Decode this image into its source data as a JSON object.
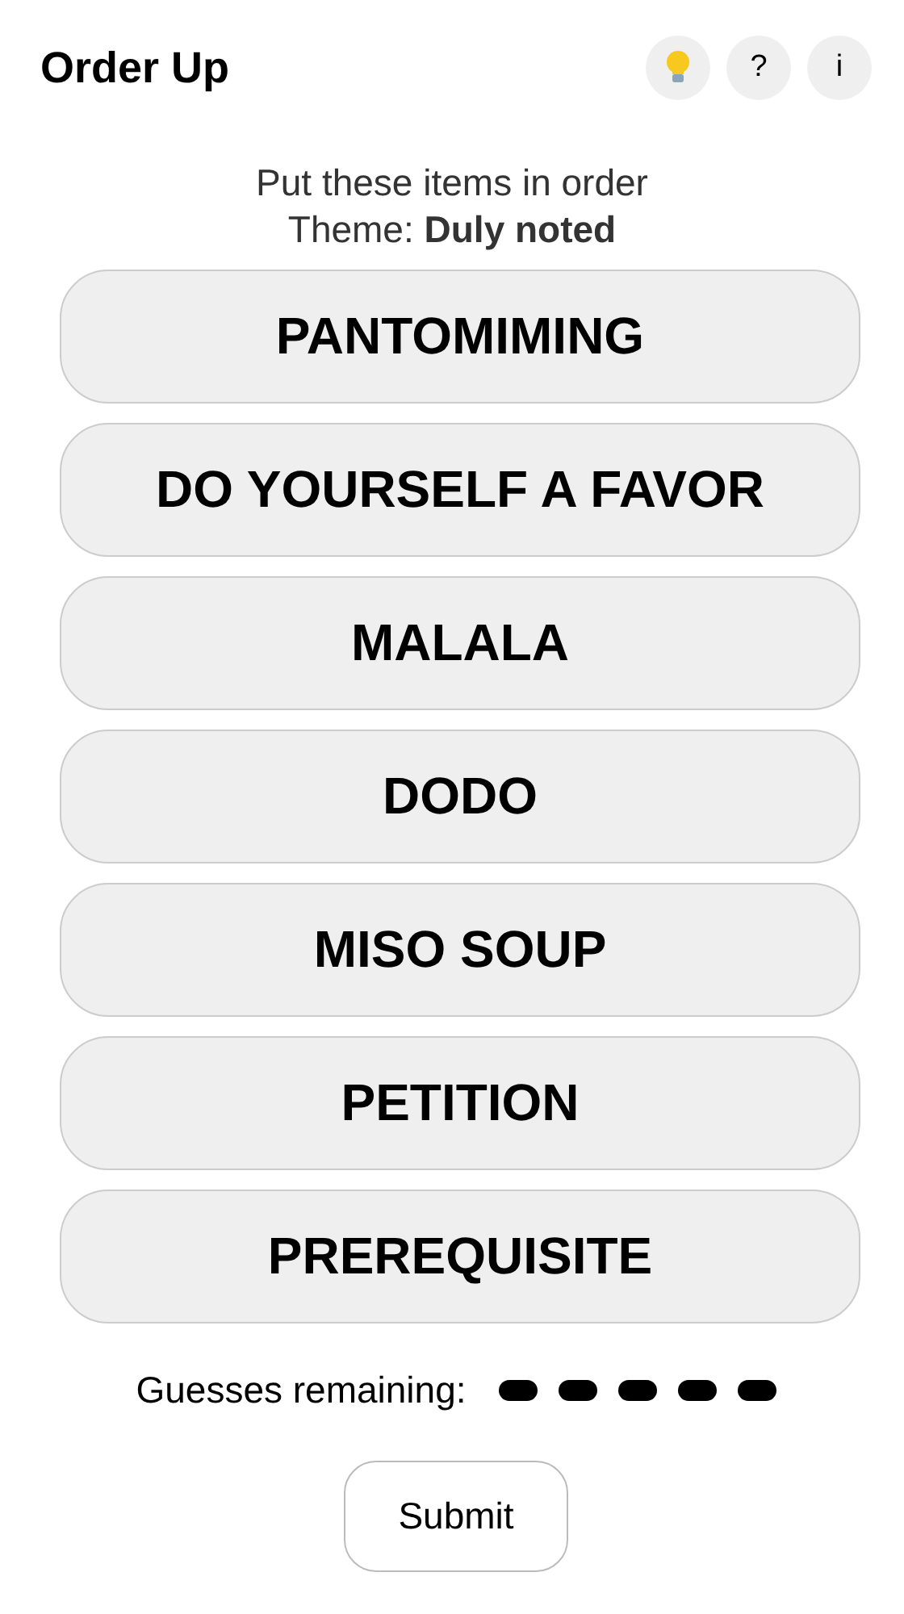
{
  "header": {
    "title": "Order Up",
    "buttons": [
      {
        "kind": "bulb"
      },
      {
        "kind": "text",
        "label": "?"
      },
      {
        "kind": "text",
        "label": "i"
      }
    ]
  },
  "instructions": {
    "prompt": "Put these items in order",
    "theme_label": "Theme:",
    "theme": "Duly noted"
  },
  "items": [
    "PANTOMIMING",
    "DO YOURSELF A FAVOR",
    "MALALA",
    "DODO",
    "MISO SOUP",
    "PETITION",
    "PREREQUISITE"
  ],
  "guesses": {
    "label": "Guesses remaining:",
    "marks": [
      {
        "used": false
      },
      {
        "used": false
      },
      {
        "used": false
      },
      {
        "used": false
      },
      {
        "used": false
      }
    ]
  },
  "submit": "Submit"
}
